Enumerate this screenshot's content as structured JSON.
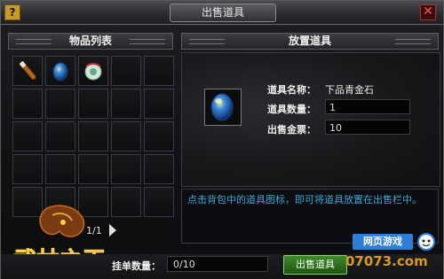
{
  "window": {
    "title": "出售道具",
    "help_label": "?",
    "close_label": "✕"
  },
  "left_panel": {
    "title": "物品列表",
    "page_indicator": "1/1"
  },
  "right_panel": {
    "title": "放置道具",
    "item_name_label": "道具名称：",
    "item_name_value": "下品青金石",
    "quantity_label": "道具数量：",
    "quantity_value": "1",
    "price_label": "出售金票：",
    "price_value": "10"
  },
  "hint": {
    "text": "点击背包中的道具图标，即可将道具放置在出售栏中。"
  },
  "bottom": {
    "listing_count_label": "挂单数量：",
    "listing_count_value": "0/10",
    "sell_button": "出售道具"
  },
  "inventory": {
    "slots": [
      {
        "icon": "brush-icon"
      },
      {
        "icon": "gem-icon"
      },
      {
        "icon": "jade-icon"
      },
      {},
      {},
      {},
      {},
      {},
      {},
      {},
      {},
      {},
      {},
      {},
      {},
      {},
      {},
      {},
      {},
      {},
      {},
      {},
      {},
      {},
      {}
    ]
  },
  "watermark": {
    "line1": "网页游戏",
    "line2": "07073.com"
  },
  "logo": {
    "text": "武林之王"
  }
}
